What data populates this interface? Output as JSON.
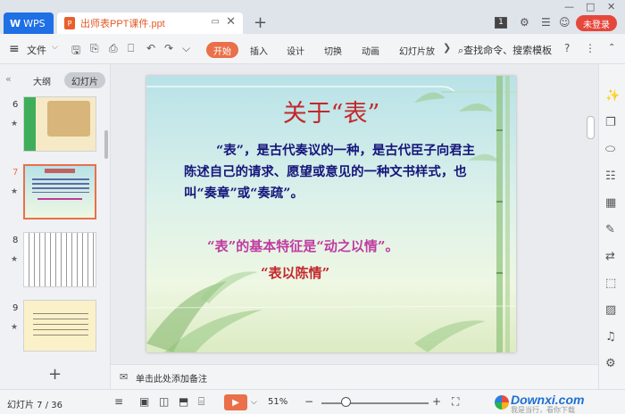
{
  "titlebar": {
    "app_tab": "WPS",
    "doc_tab": "出师表PPT课件.ppt",
    "badge": "1",
    "login": "未登录"
  },
  "toolbar": {
    "file": "文件",
    "start": "开始",
    "tabs": [
      "插入",
      "设计",
      "切换",
      "动画",
      "幻灯片放"
    ],
    "search": "查找命令、搜索模板"
  },
  "left_panel": {
    "tab_outline": "大纲",
    "tab_slides": "幻灯片",
    "thumbnails": [
      {
        "num": "6"
      },
      {
        "num": "7"
      },
      {
        "num": "8"
      },
      {
        "num": "9"
      }
    ],
    "active_slide": "7"
  },
  "slide": {
    "title": "关于“表”",
    "body": "“表”，是古代奏议的一种，是古代臣子向君主陈述自己的请求、愿望或意见的一种文书样式，也叫“奏章”或“奏疏”。",
    "line2": "“表”的基本特征是“动之以情”。",
    "line3": "“表以陈情”"
  },
  "notes": {
    "placeholder": "单击此处添加备注"
  },
  "statusbar": {
    "slide_info": "幻灯片 7 / 36",
    "zoom": "51%"
  },
  "watermark": {
    "brand": "Downxi.com",
    "sub": "我是当行，看你下载"
  },
  "colors": {
    "accent": "#e9704a",
    "wps_blue": "#1f6fe5",
    "login_red": "#e5473b",
    "slide_title": "#c3282b",
    "slide_body": "#15157a",
    "slide_pink": "#c03aa0"
  }
}
